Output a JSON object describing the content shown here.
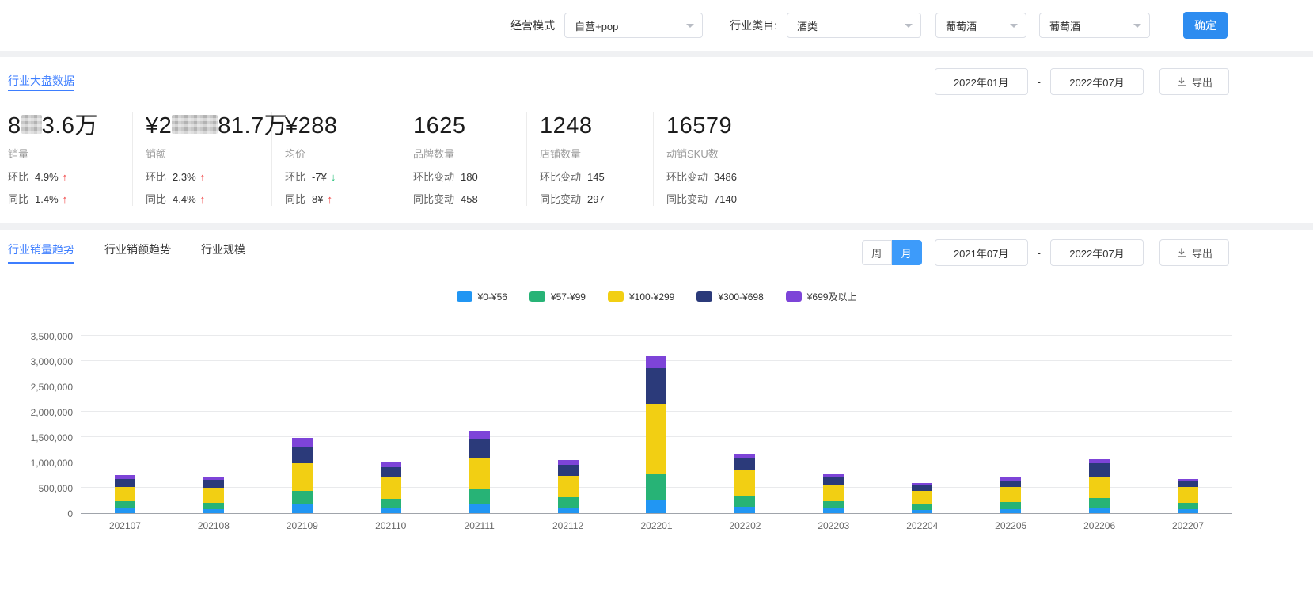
{
  "filters": {
    "mode_label": "经营模式",
    "mode_value": "自营+pop",
    "category_label": "行业类目:",
    "category_value": "酒类",
    "sub_category_value": "葡萄酒",
    "sub_sub_category_value": "葡萄酒",
    "confirm_label": "确定"
  },
  "overview": {
    "title": "行业大盘数据",
    "date_start": "2022年01月",
    "date_separator": "-",
    "date_end": "2022年07月",
    "export_label": "导出",
    "kpis": [
      {
        "value_a": "8",
        "value_b": "3.6万",
        "label": "销量",
        "m1_name": "环比",
        "m1_value": "4.9%",
        "m2_name": "同比",
        "m2_value": "1.4%"
      },
      {
        "value_a": "¥2",
        "value_b": "81.7万",
        "label": "销额",
        "m1_name": "环比",
        "m1_value": "2.3%",
        "m2_name": "同比",
        "m2_value": "4.4%"
      },
      {
        "value_a": "¥288",
        "value_b": "",
        "label": "均价",
        "m1_name": "环比",
        "m1_value": "-7¥",
        "m2_name": "同比",
        "m2_value": "8¥"
      },
      {
        "value_a": "1625",
        "value_b": "",
        "label": "品牌数量",
        "m1_name": "环比变动",
        "m1_value": "180",
        "m2_name": "同比变动",
        "m2_value": "458"
      },
      {
        "value_a": "1248",
        "value_b": "",
        "label": "店铺数量",
        "m1_name": "环比变动",
        "m1_value": "145",
        "m2_name": "同比变动",
        "m2_value": "297"
      },
      {
        "value_a": "16579",
        "value_b": "",
        "label": "动销SKU数",
        "m1_name": "环比变动",
        "m1_value": "3486",
        "m2_name": "同比变动",
        "m2_value": "7140"
      }
    ]
  },
  "trend": {
    "tabs": [
      {
        "label": "行业销量趋势",
        "active": true
      },
      {
        "label": "行业销额趋势",
        "active": false
      },
      {
        "label": "行业规模",
        "active": false
      }
    ],
    "week_label": "周",
    "month_label": "月",
    "date_start": "2021年07月",
    "date_separator": "-",
    "date_end": "2022年07月",
    "export_label": "导出"
  },
  "chart_data": {
    "type": "bar",
    "stacked": true,
    "title": "",
    "xlabel": "",
    "ylabel": "",
    "ylim": [
      0,
      3500000
    ],
    "ytick_step": 500000,
    "grid": true,
    "legend_position": "top",
    "categories": [
      "202107",
      "202108",
      "202109",
      "202110",
      "202111",
      "202112",
      "202201",
      "202202",
      "202203",
      "202204",
      "202205",
      "202206",
      "202207"
    ],
    "series": [
      {
        "name": "¥0-¥56",
        "color": "#2196f3",
        "values": [
          90000,
          80000,
          180000,
          100000,
          180000,
          110000,
          260000,
          120000,
          90000,
          70000,
          80000,
          110000,
          80000
        ]
      },
      {
        "name": "¥57-¥99",
        "color": "#27b376",
        "values": [
          140000,
          130000,
          250000,
          180000,
          290000,
          200000,
          520000,
          220000,
          150000,
          110000,
          140000,
          180000,
          130000
        ]
      },
      {
        "name": "¥100-¥299",
        "color": "#f2cf13",
        "values": [
          280000,
          290000,
          560000,
          420000,
          620000,
          420000,
          1380000,
          520000,
          330000,
          260000,
          300000,
          420000,
          310000
        ]
      },
      {
        "name": "¥300-¥698",
        "color": "#2b3a7a",
        "values": [
          160000,
          150000,
          330000,
          200000,
          370000,
          220000,
          700000,
          220000,
          140000,
          110000,
          120000,
          270000,
          110000
        ]
      },
      {
        "name": "¥699及以上",
        "color": "#7d44d8",
        "values": [
          80000,
          70000,
          160000,
          100000,
          160000,
          100000,
          240000,
          100000,
          60000,
          50000,
          60000,
          90000,
          50000
        ]
      }
    ]
  }
}
